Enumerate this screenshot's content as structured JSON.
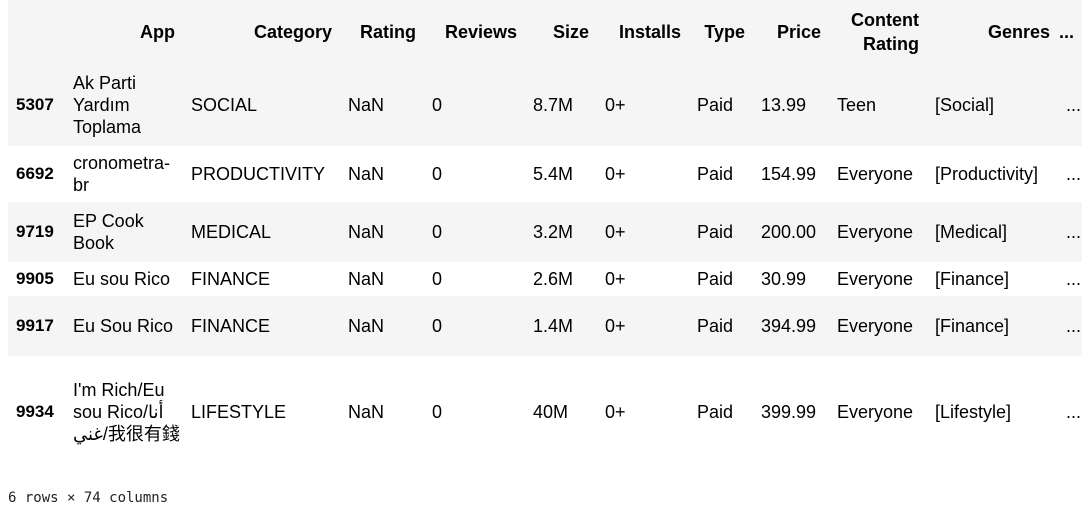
{
  "table": {
    "columns": [
      "App",
      "Category",
      "Rating",
      "Reviews",
      "Size",
      "Installs",
      "Type",
      "Price",
      "Content Rating",
      "Genres",
      "..."
    ],
    "header_lines": {
      "content_rating": [
        "Content",
        "Rating"
      ]
    },
    "rows": [
      {
        "index": "5307",
        "app": "Ak Parti Yardım Toplama",
        "category": "SOCIAL",
        "rating": "NaN",
        "reviews": "0",
        "size": "8.7M",
        "installs": "0+",
        "type": "Paid",
        "price": "13.99",
        "content_rating": "Teen",
        "genres": "[Social]",
        "more": "..."
      },
      {
        "index": "6692",
        "app": "cronometra-br",
        "category": "PRODUCTIVITY",
        "rating": "NaN",
        "reviews": "0",
        "size": "5.4M",
        "installs": "0+",
        "type": "Paid",
        "price": "154.99",
        "content_rating": "Everyone",
        "genres": "[Productivity]",
        "more": "..."
      },
      {
        "index": "9719",
        "app": "EP Cook Book",
        "category": "MEDICAL",
        "rating": "NaN",
        "reviews": "0",
        "size": "3.2M",
        "installs": "0+",
        "type": "Paid",
        "price": "200.00",
        "content_rating": "Everyone",
        "genres": "[Medical]",
        "more": "..."
      },
      {
        "index": "9905",
        "app": "Eu sou Rico",
        "category": "FINANCE",
        "rating": "NaN",
        "reviews": "0",
        "size": "2.6M",
        "installs": "0+",
        "type": "Paid",
        "price": "30.99",
        "content_rating": "Everyone",
        "genres": "[Finance]",
        "more": "..."
      },
      {
        "index": "9917",
        "app": "Eu Sou Rico",
        "category": "FINANCE",
        "rating": "NaN",
        "reviews": "0",
        "size": "1.4M",
        "installs": "0+",
        "type": "Paid",
        "price": "394.99",
        "content_rating": "Everyone",
        "genres": "[Finance]",
        "more": "..."
      },
      {
        "index": "9934",
        "app": "I'm Rich/Eu sou Rico/أنا غني/我很有錢",
        "category": "LIFESTYLE",
        "rating": "NaN",
        "reviews": "0",
        "size": "40M",
        "installs": "0+",
        "type": "Paid",
        "price": "399.99",
        "content_rating": "Everyone",
        "genres": "[Lifestyle]",
        "more": "..."
      }
    ]
  },
  "footer": {
    "shape": "6 rows × 74 columns"
  }
}
